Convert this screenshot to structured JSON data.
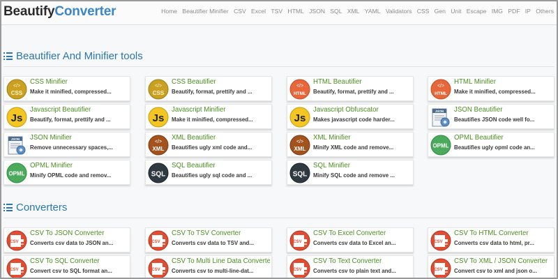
{
  "brand": {
    "part1": "Beautify",
    "part2": "Converter"
  },
  "nav": [
    "Home",
    "Beautifier Minifier",
    "CSV",
    "Excel",
    "TSV",
    "HTML",
    "JSON",
    "SQL",
    "XML",
    "YAML",
    "Validators",
    "CSS",
    "Gen",
    "Unit",
    "Escape",
    "IMG",
    "PDF",
    "IP",
    "Others"
  ],
  "sections": {
    "beautifier": {
      "title": "Beautifier And Minifier tools"
    },
    "converters": {
      "title": "Converters"
    }
  },
  "tools": [
    {
      "title": "CSS Minifier",
      "desc": "Make it minified, compressed...",
      "icon": "css-icon"
    },
    {
      "title": "CSS Beautifier",
      "desc": "Beautify, format, prettify and ...",
      "icon": "css-icon"
    },
    {
      "title": "HTML Beautifier",
      "desc": "Beautify, format, prettify and ...",
      "icon": "html-icon"
    },
    {
      "title": "HTML Minifier",
      "desc": "Make it minified, compressed...",
      "icon": "html-icon"
    },
    {
      "title": "Javascript Beautifier",
      "desc": "Beautify, format, prettify and ...",
      "icon": "javascript-icon"
    },
    {
      "title": "Javascript Minifier",
      "desc": "Make it minified, compressed...",
      "icon": "javascript-icon"
    },
    {
      "title": "Javascript Obfuscator",
      "desc": "Makes javascript code harder...",
      "icon": "javascript-icon"
    },
    {
      "title": "JSON Beautifier",
      "desc": "Beautifies JSON code well fo...",
      "icon": "json-icon"
    },
    {
      "title": "JSON Minifier",
      "desc": "Remove unnecessary spaces,...",
      "icon": "json-icon"
    },
    {
      "title": "XML Beautifier",
      "desc": "Beautifies ugly xml code and...",
      "icon": "xml-icon"
    },
    {
      "title": "XML Minifier",
      "desc": "Minify XML code and remove...",
      "icon": "xml-icon"
    },
    {
      "title": "OPML Beautifier",
      "desc": "Beautifies ugly opml code an...",
      "icon": "opml-icon"
    },
    {
      "title": "OPML Minifier",
      "desc": "Minify OPML code and remov...",
      "icon": "opml-icon"
    },
    {
      "title": "SQL Beautifier",
      "desc": "Beautifies ugly sql code and ...",
      "icon": "sql-icon"
    },
    {
      "title": "SQL Minifier",
      "desc": "Minify SQL code and remove ...",
      "icon": "sql-icon"
    }
  ],
  "converters": [
    {
      "title": "CSV To JSON Converter",
      "desc": "Converts csv data to JSON an...",
      "icon": "csv-icon"
    },
    {
      "title": "CSV To TSV Converter",
      "desc": "Converts csv data to TSV and...",
      "icon": "csv-icon"
    },
    {
      "title": "CSV To Excel Converter",
      "desc": "Converts csv data to Excel an...",
      "icon": "csv-icon"
    },
    {
      "title": "CSV To HTML Converter",
      "desc": "Converts csv data to html, pr...",
      "icon": "csv-icon"
    },
    {
      "title": "CSV To SQL Converter",
      "desc": "Convert csv to SQL format an...",
      "icon": "csv-icon"
    },
    {
      "title": "CSV To Multi Line Data Converter",
      "desc": "Converts csv to multi-line-dat...",
      "icon": "csv-icon"
    },
    {
      "title": "CSV To Text Converter",
      "desc": "Converts csv to plain text and...",
      "icon": "csv-icon"
    },
    {
      "title": "CSV To XML / JSON Converter",
      "desc": "Convert csv to xml and json o...",
      "icon": "csv-icon"
    }
  ],
  "icon_labels": {
    "css": "CSS",
    "html": "HTML",
    "js": "Js",
    "json": "JSON",
    "xml": "XML",
    "opml": "OPML",
    "sql": "SQL",
    "csv": "CSV"
  },
  "colors": {
    "brand_dark": "#2b2b2b",
    "brand_accent": "#3a86c8",
    "section_title": "#2a76ac",
    "card_title": "#4a8f20"
  }
}
